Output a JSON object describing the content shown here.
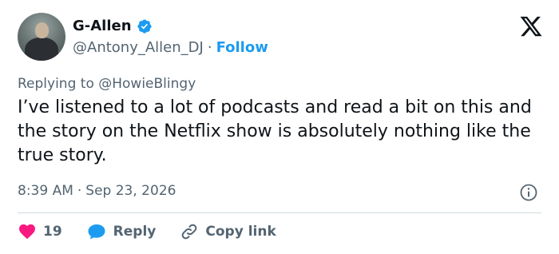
{
  "user": {
    "display_name": "G-Allen",
    "handle": "@Antony_Allen_DJ",
    "separator": "·",
    "follow_label": "Follow"
  },
  "reply_context": {
    "prefix": "Replying to ",
    "mention": "@HowieBlingy"
  },
  "tweet": {
    "text": "I’ve listened to a lot of podcasts and read a bit on this and the story on the Netflix show is absolutely nothing like the true story.",
    "time": "8:39 AM",
    "separator": "·",
    "date": "Sep 23, 2026"
  },
  "actions": {
    "like_count": "19",
    "reply_label": "Reply",
    "copy_link_label": "Copy link"
  },
  "icons": {
    "logo": "x-logo-icon",
    "verified": "verified-badge-icon",
    "info": "info-icon",
    "like": "heart-icon",
    "reply": "reply-bubble-icon",
    "copy": "link-icon"
  },
  "colors": {
    "accent": "#1d9bf0",
    "like": "#f91880",
    "text_primary": "#0f1419",
    "text_secondary": "#536471",
    "divider": "#cfd9de"
  }
}
